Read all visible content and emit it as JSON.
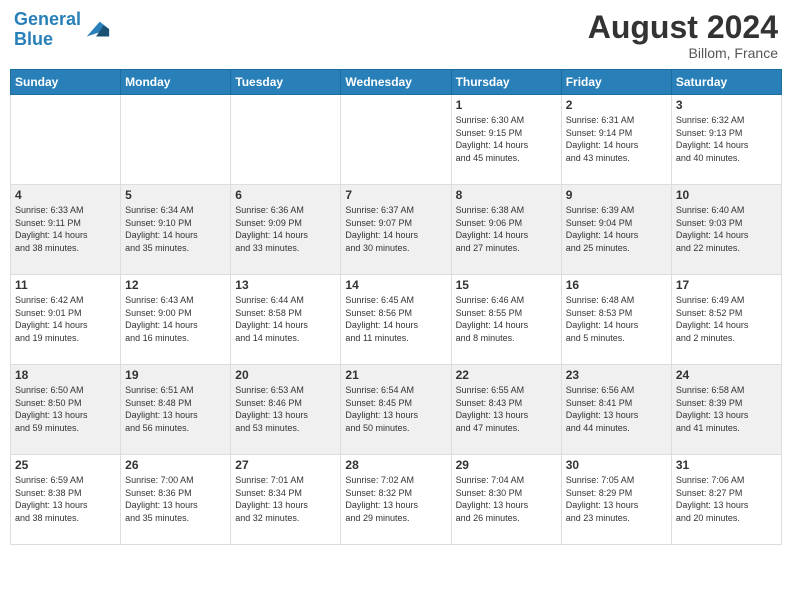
{
  "header": {
    "logo_line1": "General",
    "logo_line2": "Blue",
    "month_year": "August 2024",
    "location": "Billom, France"
  },
  "days_of_week": [
    "Sunday",
    "Monday",
    "Tuesday",
    "Wednesday",
    "Thursday",
    "Friday",
    "Saturday"
  ],
  "weeks": [
    [
      {
        "day": "",
        "info": ""
      },
      {
        "day": "",
        "info": ""
      },
      {
        "day": "",
        "info": ""
      },
      {
        "day": "",
        "info": ""
      },
      {
        "day": "1",
        "info": "Sunrise: 6:30 AM\nSunset: 9:15 PM\nDaylight: 14 hours\nand 45 minutes."
      },
      {
        "day": "2",
        "info": "Sunrise: 6:31 AM\nSunset: 9:14 PM\nDaylight: 14 hours\nand 43 minutes."
      },
      {
        "day": "3",
        "info": "Sunrise: 6:32 AM\nSunset: 9:13 PM\nDaylight: 14 hours\nand 40 minutes."
      }
    ],
    [
      {
        "day": "4",
        "info": "Sunrise: 6:33 AM\nSunset: 9:11 PM\nDaylight: 14 hours\nand 38 minutes."
      },
      {
        "day": "5",
        "info": "Sunrise: 6:34 AM\nSunset: 9:10 PM\nDaylight: 14 hours\nand 35 minutes."
      },
      {
        "day": "6",
        "info": "Sunrise: 6:36 AM\nSunset: 9:09 PM\nDaylight: 14 hours\nand 33 minutes."
      },
      {
        "day": "7",
        "info": "Sunrise: 6:37 AM\nSunset: 9:07 PM\nDaylight: 14 hours\nand 30 minutes."
      },
      {
        "day": "8",
        "info": "Sunrise: 6:38 AM\nSunset: 9:06 PM\nDaylight: 14 hours\nand 27 minutes."
      },
      {
        "day": "9",
        "info": "Sunrise: 6:39 AM\nSunset: 9:04 PM\nDaylight: 14 hours\nand 25 minutes."
      },
      {
        "day": "10",
        "info": "Sunrise: 6:40 AM\nSunset: 9:03 PM\nDaylight: 14 hours\nand 22 minutes."
      }
    ],
    [
      {
        "day": "11",
        "info": "Sunrise: 6:42 AM\nSunset: 9:01 PM\nDaylight: 14 hours\nand 19 minutes."
      },
      {
        "day": "12",
        "info": "Sunrise: 6:43 AM\nSunset: 9:00 PM\nDaylight: 14 hours\nand 16 minutes."
      },
      {
        "day": "13",
        "info": "Sunrise: 6:44 AM\nSunset: 8:58 PM\nDaylight: 14 hours\nand 14 minutes."
      },
      {
        "day": "14",
        "info": "Sunrise: 6:45 AM\nSunset: 8:56 PM\nDaylight: 14 hours\nand 11 minutes."
      },
      {
        "day": "15",
        "info": "Sunrise: 6:46 AM\nSunset: 8:55 PM\nDaylight: 14 hours\nand 8 minutes."
      },
      {
        "day": "16",
        "info": "Sunrise: 6:48 AM\nSunset: 8:53 PM\nDaylight: 14 hours\nand 5 minutes."
      },
      {
        "day": "17",
        "info": "Sunrise: 6:49 AM\nSunset: 8:52 PM\nDaylight: 14 hours\nand 2 minutes."
      }
    ],
    [
      {
        "day": "18",
        "info": "Sunrise: 6:50 AM\nSunset: 8:50 PM\nDaylight: 13 hours\nand 59 minutes."
      },
      {
        "day": "19",
        "info": "Sunrise: 6:51 AM\nSunset: 8:48 PM\nDaylight: 13 hours\nand 56 minutes."
      },
      {
        "day": "20",
        "info": "Sunrise: 6:53 AM\nSunset: 8:46 PM\nDaylight: 13 hours\nand 53 minutes."
      },
      {
        "day": "21",
        "info": "Sunrise: 6:54 AM\nSunset: 8:45 PM\nDaylight: 13 hours\nand 50 minutes."
      },
      {
        "day": "22",
        "info": "Sunrise: 6:55 AM\nSunset: 8:43 PM\nDaylight: 13 hours\nand 47 minutes."
      },
      {
        "day": "23",
        "info": "Sunrise: 6:56 AM\nSunset: 8:41 PM\nDaylight: 13 hours\nand 44 minutes."
      },
      {
        "day": "24",
        "info": "Sunrise: 6:58 AM\nSunset: 8:39 PM\nDaylight: 13 hours\nand 41 minutes."
      }
    ],
    [
      {
        "day": "25",
        "info": "Sunrise: 6:59 AM\nSunset: 8:38 PM\nDaylight: 13 hours\nand 38 minutes."
      },
      {
        "day": "26",
        "info": "Sunrise: 7:00 AM\nSunset: 8:36 PM\nDaylight: 13 hours\nand 35 minutes."
      },
      {
        "day": "27",
        "info": "Sunrise: 7:01 AM\nSunset: 8:34 PM\nDaylight: 13 hours\nand 32 minutes."
      },
      {
        "day": "28",
        "info": "Sunrise: 7:02 AM\nSunset: 8:32 PM\nDaylight: 13 hours\nand 29 minutes."
      },
      {
        "day": "29",
        "info": "Sunrise: 7:04 AM\nSunset: 8:30 PM\nDaylight: 13 hours\nand 26 minutes."
      },
      {
        "day": "30",
        "info": "Sunrise: 7:05 AM\nSunset: 8:29 PM\nDaylight: 13 hours\nand 23 minutes."
      },
      {
        "day": "31",
        "info": "Sunrise: 7:06 AM\nSunset: 8:27 PM\nDaylight: 13 hours\nand 20 minutes."
      }
    ]
  ]
}
